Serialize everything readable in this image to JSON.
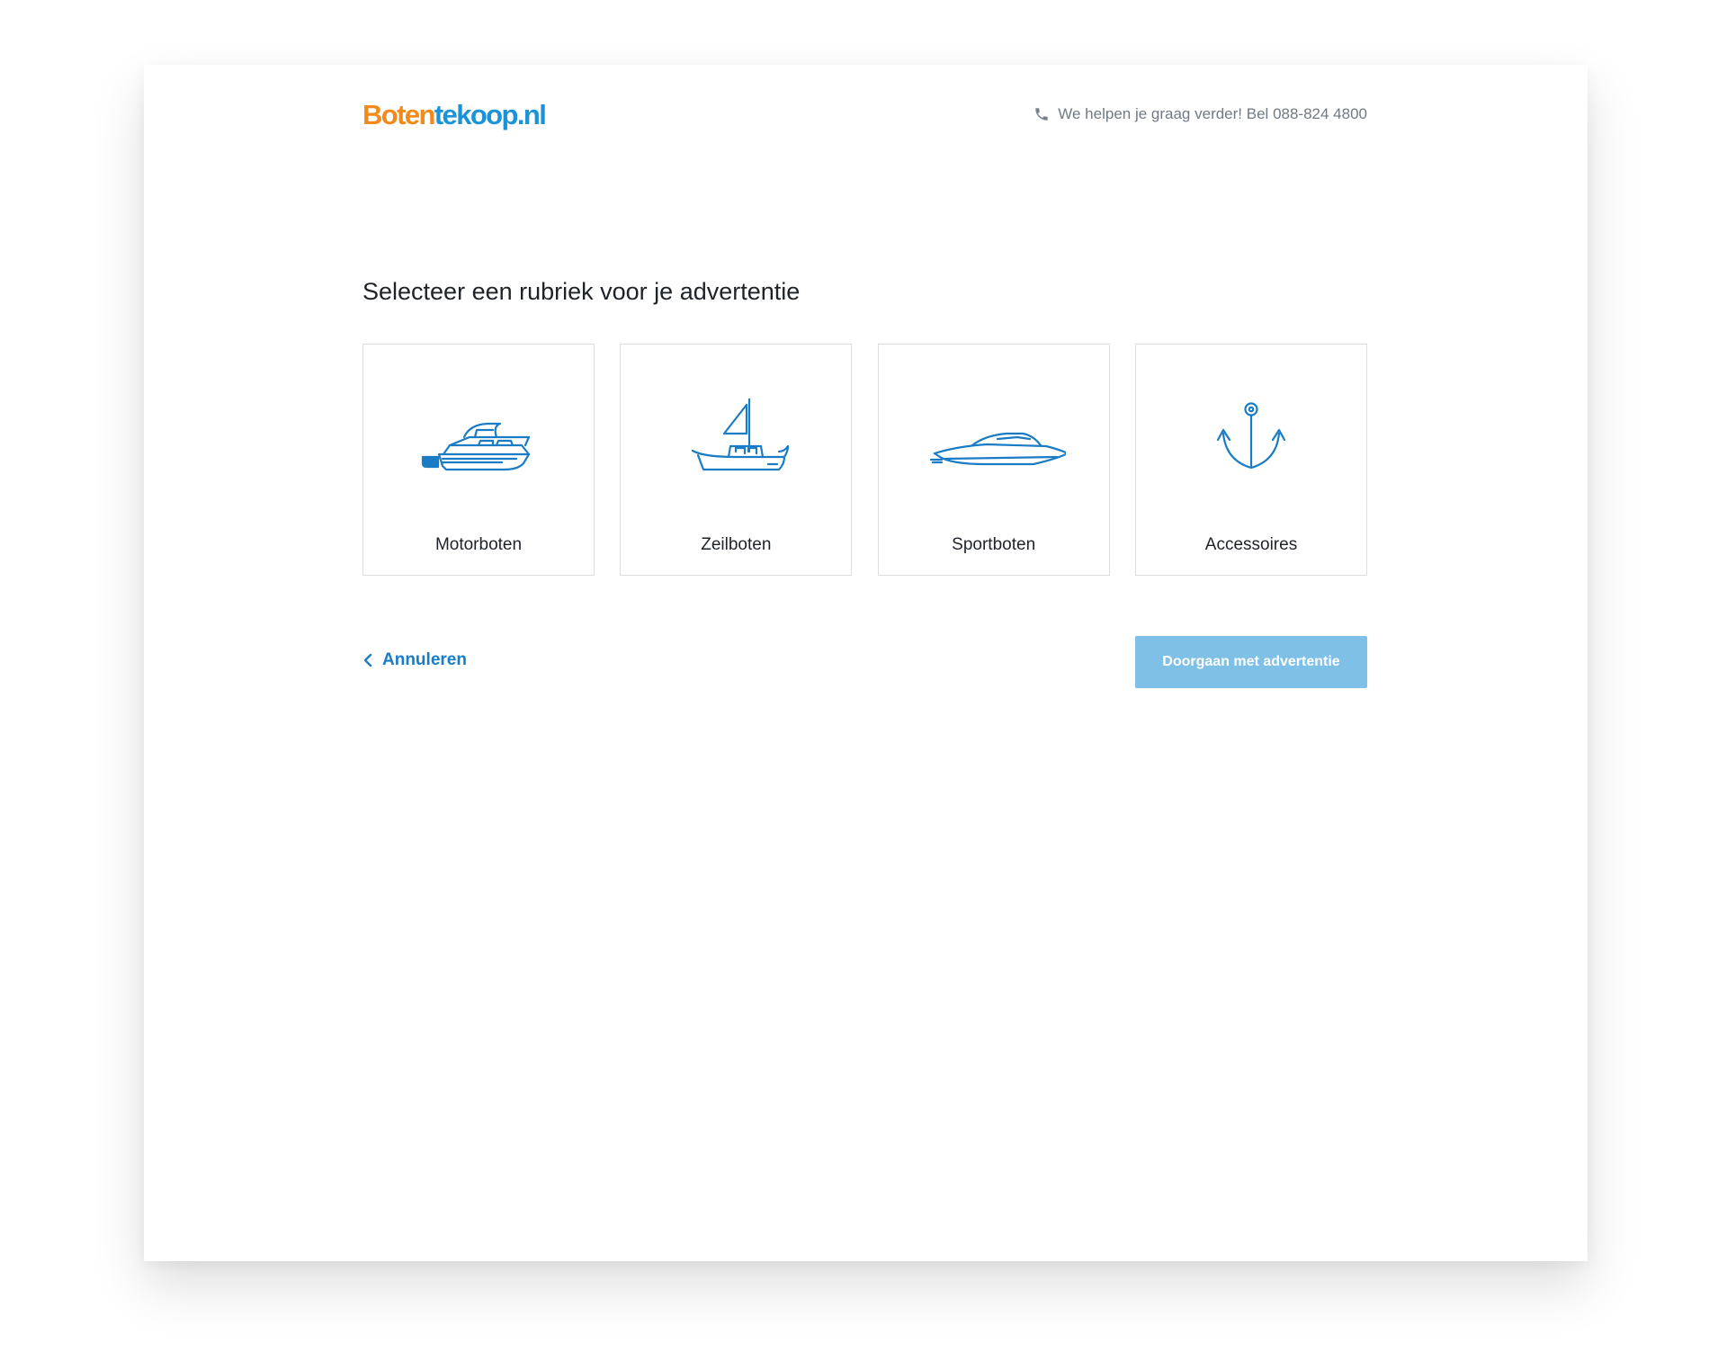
{
  "header": {
    "logo": {
      "part1": "Boten",
      "part2": "tekoop",
      "part3": ".nl"
    },
    "helpline": {
      "icon": "phone-icon",
      "text": "We helpen je graag verder! Bel",
      "phone": "088-824 4800"
    }
  },
  "main": {
    "title": "Selecteer een rubriek voor je advertentie",
    "categories": [
      {
        "label": "Motorboten",
        "icon": "motorboat-icon"
      },
      {
        "label": "Zeilboten",
        "icon": "sailboat-icon"
      },
      {
        "label": "Sportboten",
        "icon": "speedboat-icon"
      },
      {
        "label": "Accessoires",
        "icon": "anchor-icon"
      }
    ]
  },
  "footer": {
    "cancel_label": "Annuleren",
    "continue_label": "Doorgaan met advertentie",
    "continue_disabled": true
  },
  "colors": {
    "brand_orange": "#f18a1a",
    "brand_blue": "#1a93d8",
    "link_blue": "#1a7cc4",
    "button_disabled": "#7fc0e6"
  }
}
